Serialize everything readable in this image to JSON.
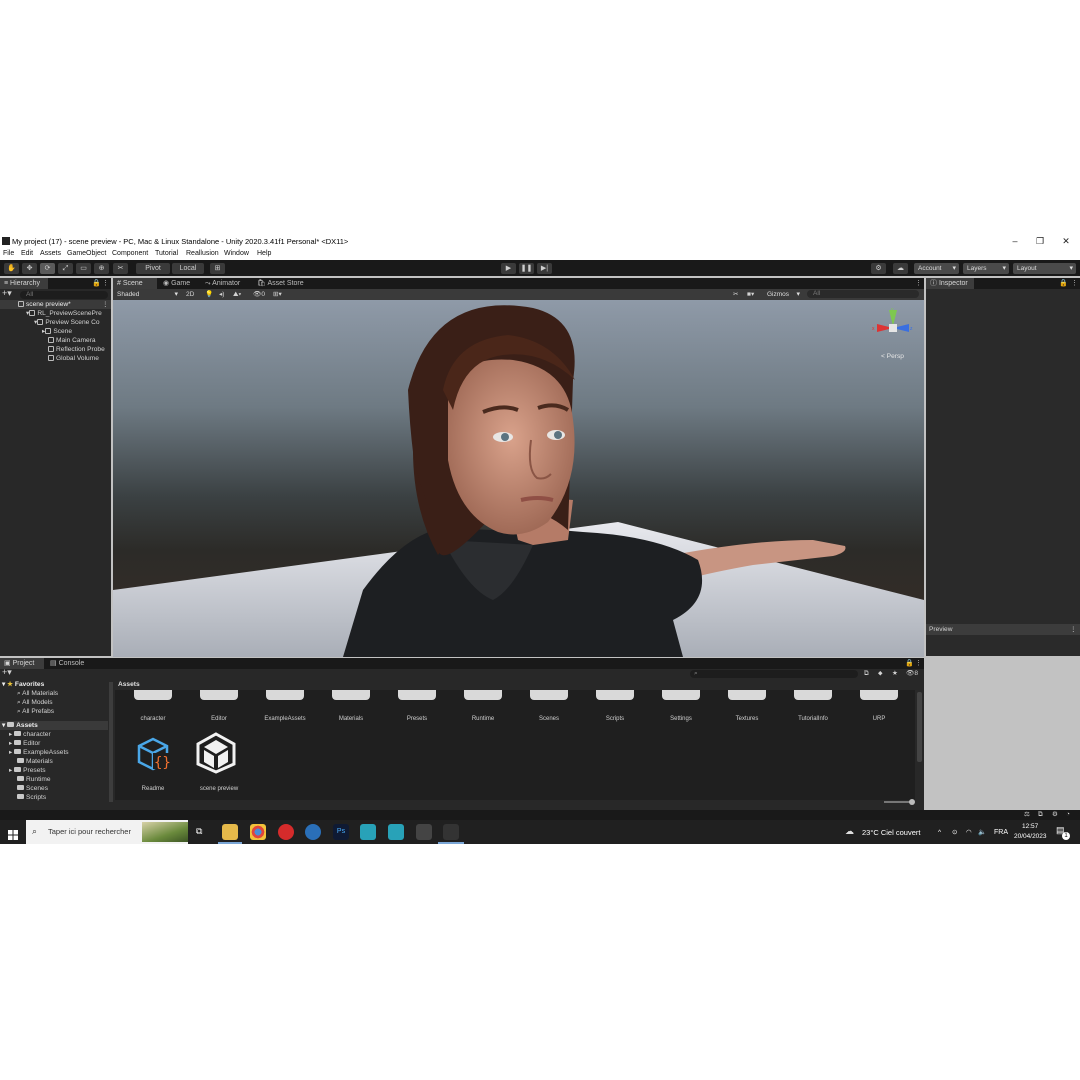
{
  "window": {
    "title": "My project (17) - scene preview - PC, Mac & Linux Standalone - Unity 2020.3.41f1 Personal* <DX11>"
  },
  "menu": [
    "File",
    "Edit",
    "Assets",
    "GameObject",
    "Component",
    "Tutorial",
    "Reallusion",
    "Window",
    "Help"
  ],
  "toolbar": {
    "pivot": "Pivot",
    "local": "Local",
    "account": "Account",
    "layers": "Layers",
    "layout": "Layout"
  },
  "hierarchy": {
    "tab": "Hierarchy",
    "search_placeholder": "All",
    "scene": "scene preview*",
    "items": [
      "RL_PreviewScenePre",
      "Preview Scene Co",
      "Scene",
      "Main Camera",
      "Reflection Probe",
      "Global Volume"
    ]
  },
  "scene_tabs": [
    "Scene",
    "Game",
    "Animator",
    "Asset Store"
  ],
  "scene_bar": {
    "shading": "Shaded",
    "mode_2d": "2D",
    "gizmos": "Gizmos",
    "search_placeholder": "All",
    "persp": "< Persp"
  },
  "inspector": {
    "tab": "Inspector",
    "preview": "Preview"
  },
  "project": {
    "tabs": [
      "Project",
      "Console"
    ],
    "favorites": "Favorites",
    "fav_items": [
      "All Materials",
      "All Models",
      "All Prefabs"
    ],
    "assets_label": "Assets",
    "tree": [
      "character",
      "Editor",
      "ExampleAssets",
      "Materials",
      "Presets",
      "Runtime",
      "Scenes",
      "Scripts"
    ],
    "breadcrumb": "Assets",
    "folders": [
      "character",
      "Editor",
      "ExampleAssets",
      "Materials",
      "Presets",
      "Runtime",
      "Scenes",
      "Scripts",
      "Settings",
      "Textures",
      "TutorialInfo",
      "URP"
    ],
    "files": [
      "Readme",
      "scene preview"
    ],
    "badge": "8"
  },
  "taskbar": {
    "search_placeholder": "Taper ici pour rechercher",
    "weather": "23°C  Ciel couvert",
    "lang": "FRA",
    "time": "12:57",
    "date": "20/04/2023",
    "notif": "1"
  },
  "colors": {
    "accent": "#4a8cd4",
    "chrome": "#191919",
    "panel": "#282828",
    "tab": "#3c3c3c"
  }
}
